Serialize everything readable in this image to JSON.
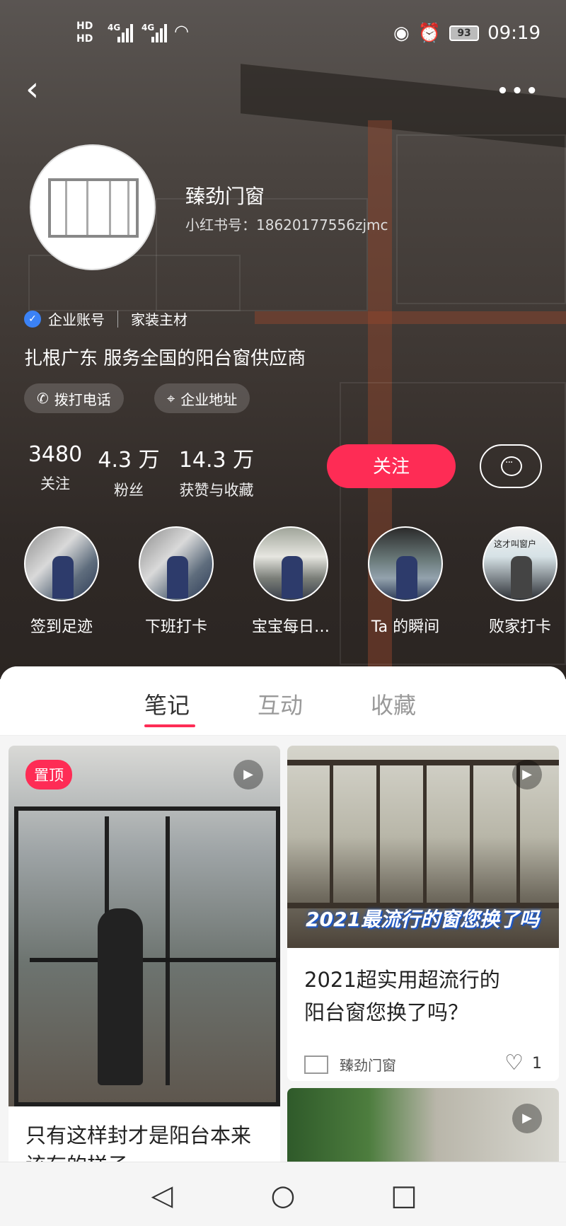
{
  "status": {
    "hd1": "HD",
    "hd2": "HD",
    "net1": "4G",
    "net2": "4G",
    "battery": "93",
    "time": "09:19"
  },
  "profile": {
    "name": "臻劲门窗",
    "uid": "小红书号：18620177556zjmc",
    "account_type": "企业账号",
    "category": "家装主材",
    "bio": "扎根广东 服务全国的阳台窗供应商",
    "call_label": "拨打电话",
    "address_label": "企业地址"
  },
  "stats": [
    {
      "num": "3480",
      "label": "关注"
    },
    {
      "num": "4.3 万",
      "label": "粉丝"
    },
    {
      "num": "14.3 万",
      "label": "获赞与收藏"
    }
  ],
  "actions": {
    "follow_label": "关注"
  },
  "highlights": [
    {
      "label": "签到足迹"
    },
    {
      "label": "下班打卡"
    },
    {
      "label": "宝宝每日…"
    },
    {
      "label": "Ta 的瞬间"
    },
    {
      "label": "败家打卡"
    }
  ],
  "highlight_overlay": "这才叫窗户",
  "tabs": [
    "笔记",
    "互动",
    "收藏"
  ],
  "notes": {
    "left": {
      "pin_label": "置顶",
      "title": "只有这样封才是阳台本来该有的样子"
    },
    "right": {
      "caption": "2021最流行的窗您换了吗",
      "title_line1": "2021超实用超流行的",
      "title_line2": "阳台窗您换了吗？",
      "author": "臻劲门窗",
      "likes": "1"
    }
  },
  "colors": {
    "accent": "#fe2c55",
    "verified": "#3b82f6"
  }
}
